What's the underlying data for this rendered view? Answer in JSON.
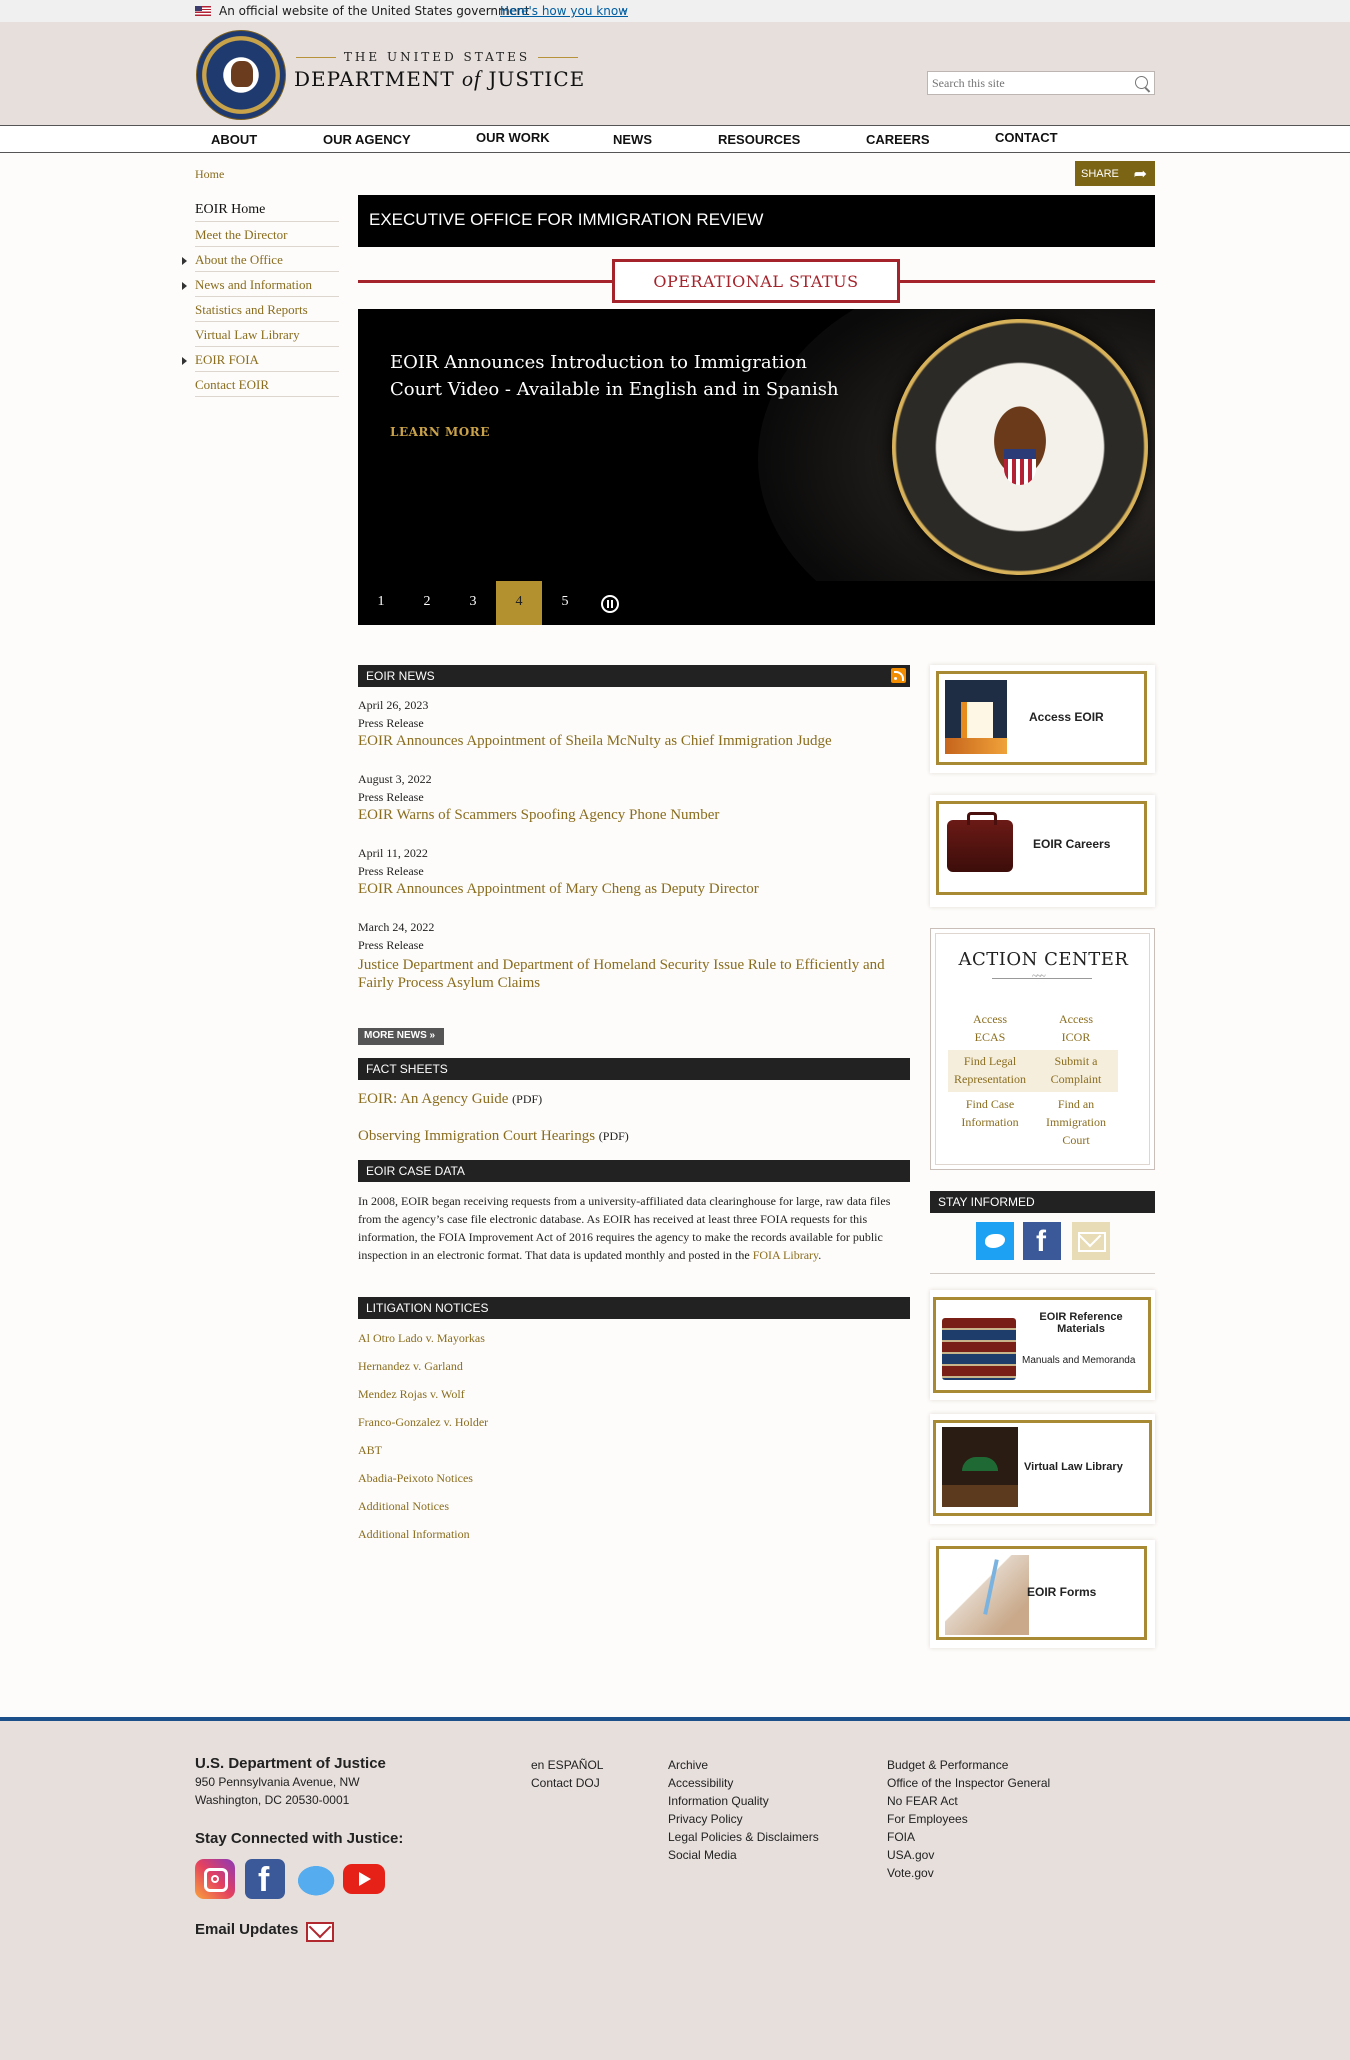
{
  "gov_banner": {
    "official_text": "An official website of the United States government",
    "how_link": "Here's how you know"
  },
  "header": {
    "wordmark_top": "THE UNITED STATES",
    "wordmark_main_left": "DEPARTMENT",
    "wordmark_main_of": "of",
    "wordmark_main_right": "JUSTICE",
    "search_placeholder": "Search this site"
  },
  "mainnav": [
    "ABOUT",
    "OUR AGENCY",
    "OUR WORK",
    "NEWS",
    "RESOURCES",
    "CAREERS",
    "CONTACT"
  ],
  "breadcrumb": "Home",
  "share_label": "SHARE",
  "sidenav": [
    {
      "label": "EOIR Home",
      "expandable": false
    },
    {
      "label": "Meet the Director",
      "expandable": false
    },
    {
      "label": "About the Office",
      "expandable": true
    },
    {
      "label": "News and Information",
      "expandable": true
    },
    {
      "label": "Statistics and Reports",
      "expandable": false
    },
    {
      "label": "Virtual Law Library",
      "expandable": false
    },
    {
      "label": "EOIR FOIA",
      "expandable": true
    },
    {
      "label": "Contact EOIR",
      "expandable": false
    }
  ],
  "office_title": "EXECUTIVE OFFICE FOR IMMIGRATION REVIEW",
  "operational_status": "OPERATIONAL STATUS",
  "carousel": {
    "headline": "EOIR Announces Introduction to Immigration Court Video - Available in English and in Spanish",
    "learn_more": "LEARN MORE",
    "pages": [
      "1",
      "2",
      "3",
      "4",
      "5"
    ],
    "active_page": "4"
  },
  "eoir_news": {
    "title": "EOIR NEWS",
    "items": [
      {
        "date": "April 26, 2023",
        "type": "Press Release",
        "title": "EOIR Announces Appointment of Sheila McNulty as Chief Immigration Judge"
      },
      {
        "date": "August 3, 2022",
        "type": "Press Release",
        "title": "EOIR Warns of Scammers Spoofing Agency Phone Number"
      },
      {
        "date": "April 11, 2022",
        "type": "Press Release",
        "title": "EOIR Announces Appointment of Mary Cheng as Deputy Director"
      },
      {
        "date": "March 24, 2022",
        "type": "Press Release",
        "title": "Justice Department and Department of Homeland Security Issue Rule to Efficiently and Fairly Process Asylum Claims"
      }
    ],
    "more_label": "MORE NEWS »"
  },
  "fact_sheets": {
    "title": "FACT SHEETS",
    "items": [
      {
        "label": "EOIR: An Agency Guide",
        "suffix": "(PDF)"
      },
      {
        "label": "Observing Immigration Court Hearings",
        "suffix": "(PDF)"
      }
    ]
  },
  "case_data": {
    "title": "EOIR CASE DATA",
    "text": "In 2008, EOIR began receiving requests from a university-affiliated data clearinghouse for large, raw data files from the agency’s case file electronic database. As EOIR has received at least three FOIA requests for this information, the FOIA Improvement Act of 2016 requires the agency to make the records available for public inspection in an electronic format. That data is updated monthly and posted in the",
    "link": "FOIA Library",
    "end": "."
  },
  "litigation": {
    "title": "LITIGATION NOTICES",
    "items": [
      "Al Otro Lado v. Mayorkas",
      "Hernandez v. Garland",
      "Mendez Rojas v. Wolf",
      "Franco-Gonzalez v. Holder",
      "ABT",
      "Abadia-Peixoto Notices",
      "Additional Notices",
      "Additional Information"
    ]
  },
  "promos": {
    "access": "Access EOIR",
    "careers": "EOIR Careers",
    "reference_title": "EOIR Reference Materials",
    "reference_sub": "Manuals and Memoranda",
    "library": "Virtual Law Library",
    "forms": "EOIR Forms"
  },
  "action_center": {
    "title": "ACTION CENTER",
    "links": [
      {
        "l1": "Access",
        "l2": "ECAS"
      },
      {
        "l1": "Access",
        "l2": "ICOR"
      },
      {
        "l1": "Find Legal",
        "l2": "Representation"
      },
      {
        "l1": "Submit a",
        "l2": "Complaint"
      },
      {
        "l1": "Find Case",
        "l2": "Information"
      },
      {
        "l1": "Find an",
        "l2": "Immigration",
        "l3": "Court"
      }
    ]
  },
  "stay_informed": "STAY INFORMED",
  "footer": {
    "org": "U.S. Department of Justice",
    "addr1": "950 Pennsylvania Avenue, NW",
    "addr2": "Washington, DC 20530-0001",
    "stay_connected": "Stay Connected with Justice:",
    "email_updates": "Email Updates",
    "col1": [
      "en ESPAÑOL",
      "Contact DOJ"
    ],
    "col2": [
      "Archive",
      "Accessibility",
      "Information Quality",
      "Privacy Policy",
      "Legal Policies & Disclaimers",
      "Social Media"
    ],
    "col3": [
      "Budget & Performance",
      "Office of the Inspector General",
      "No FEAR Act",
      "For Employees",
      "FOIA",
      "USA.gov",
      "Vote.gov"
    ]
  }
}
